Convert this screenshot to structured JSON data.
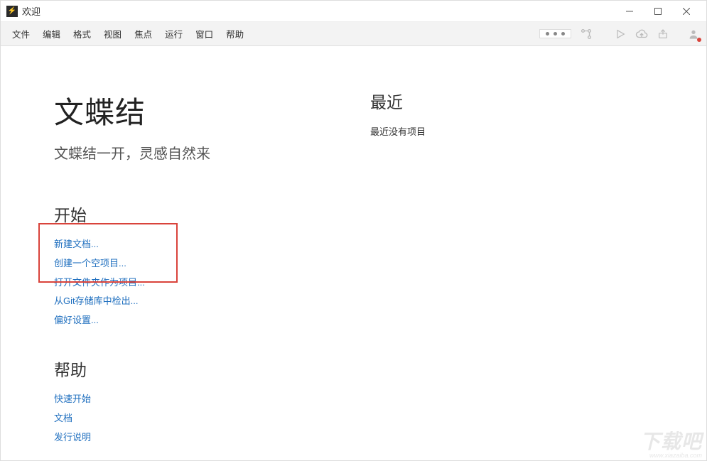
{
  "window": {
    "title": "欢迎"
  },
  "menubar": {
    "items": [
      "文件",
      "编辑",
      "格式",
      "视图",
      "焦点",
      "运行",
      "窗口",
      "帮助"
    ]
  },
  "welcome": {
    "title": "文蝶结",
    "subtitle": "文蝶结一开，灵感自然来"
  },
  "start": {
    "header": "开始",
    "links": [
      "新建文档...",
      "创建一个空项目...",
      "打开文件夹作为项目...",
      "从Git存储库中检出...",
      "偏好设置..."
    ]
  },
  "help": {
    "header": "帮助",
    "links": [
      "快速开始",
      "文档",
      "发行说明"
    ]
  },
  "recent": {
    "header": "最近",
    "empty": "最近没有项目"
  },
  "watermark": {
    "main": "下载吧",
    "sub": "www.xiazaiba.com"
  }
}
